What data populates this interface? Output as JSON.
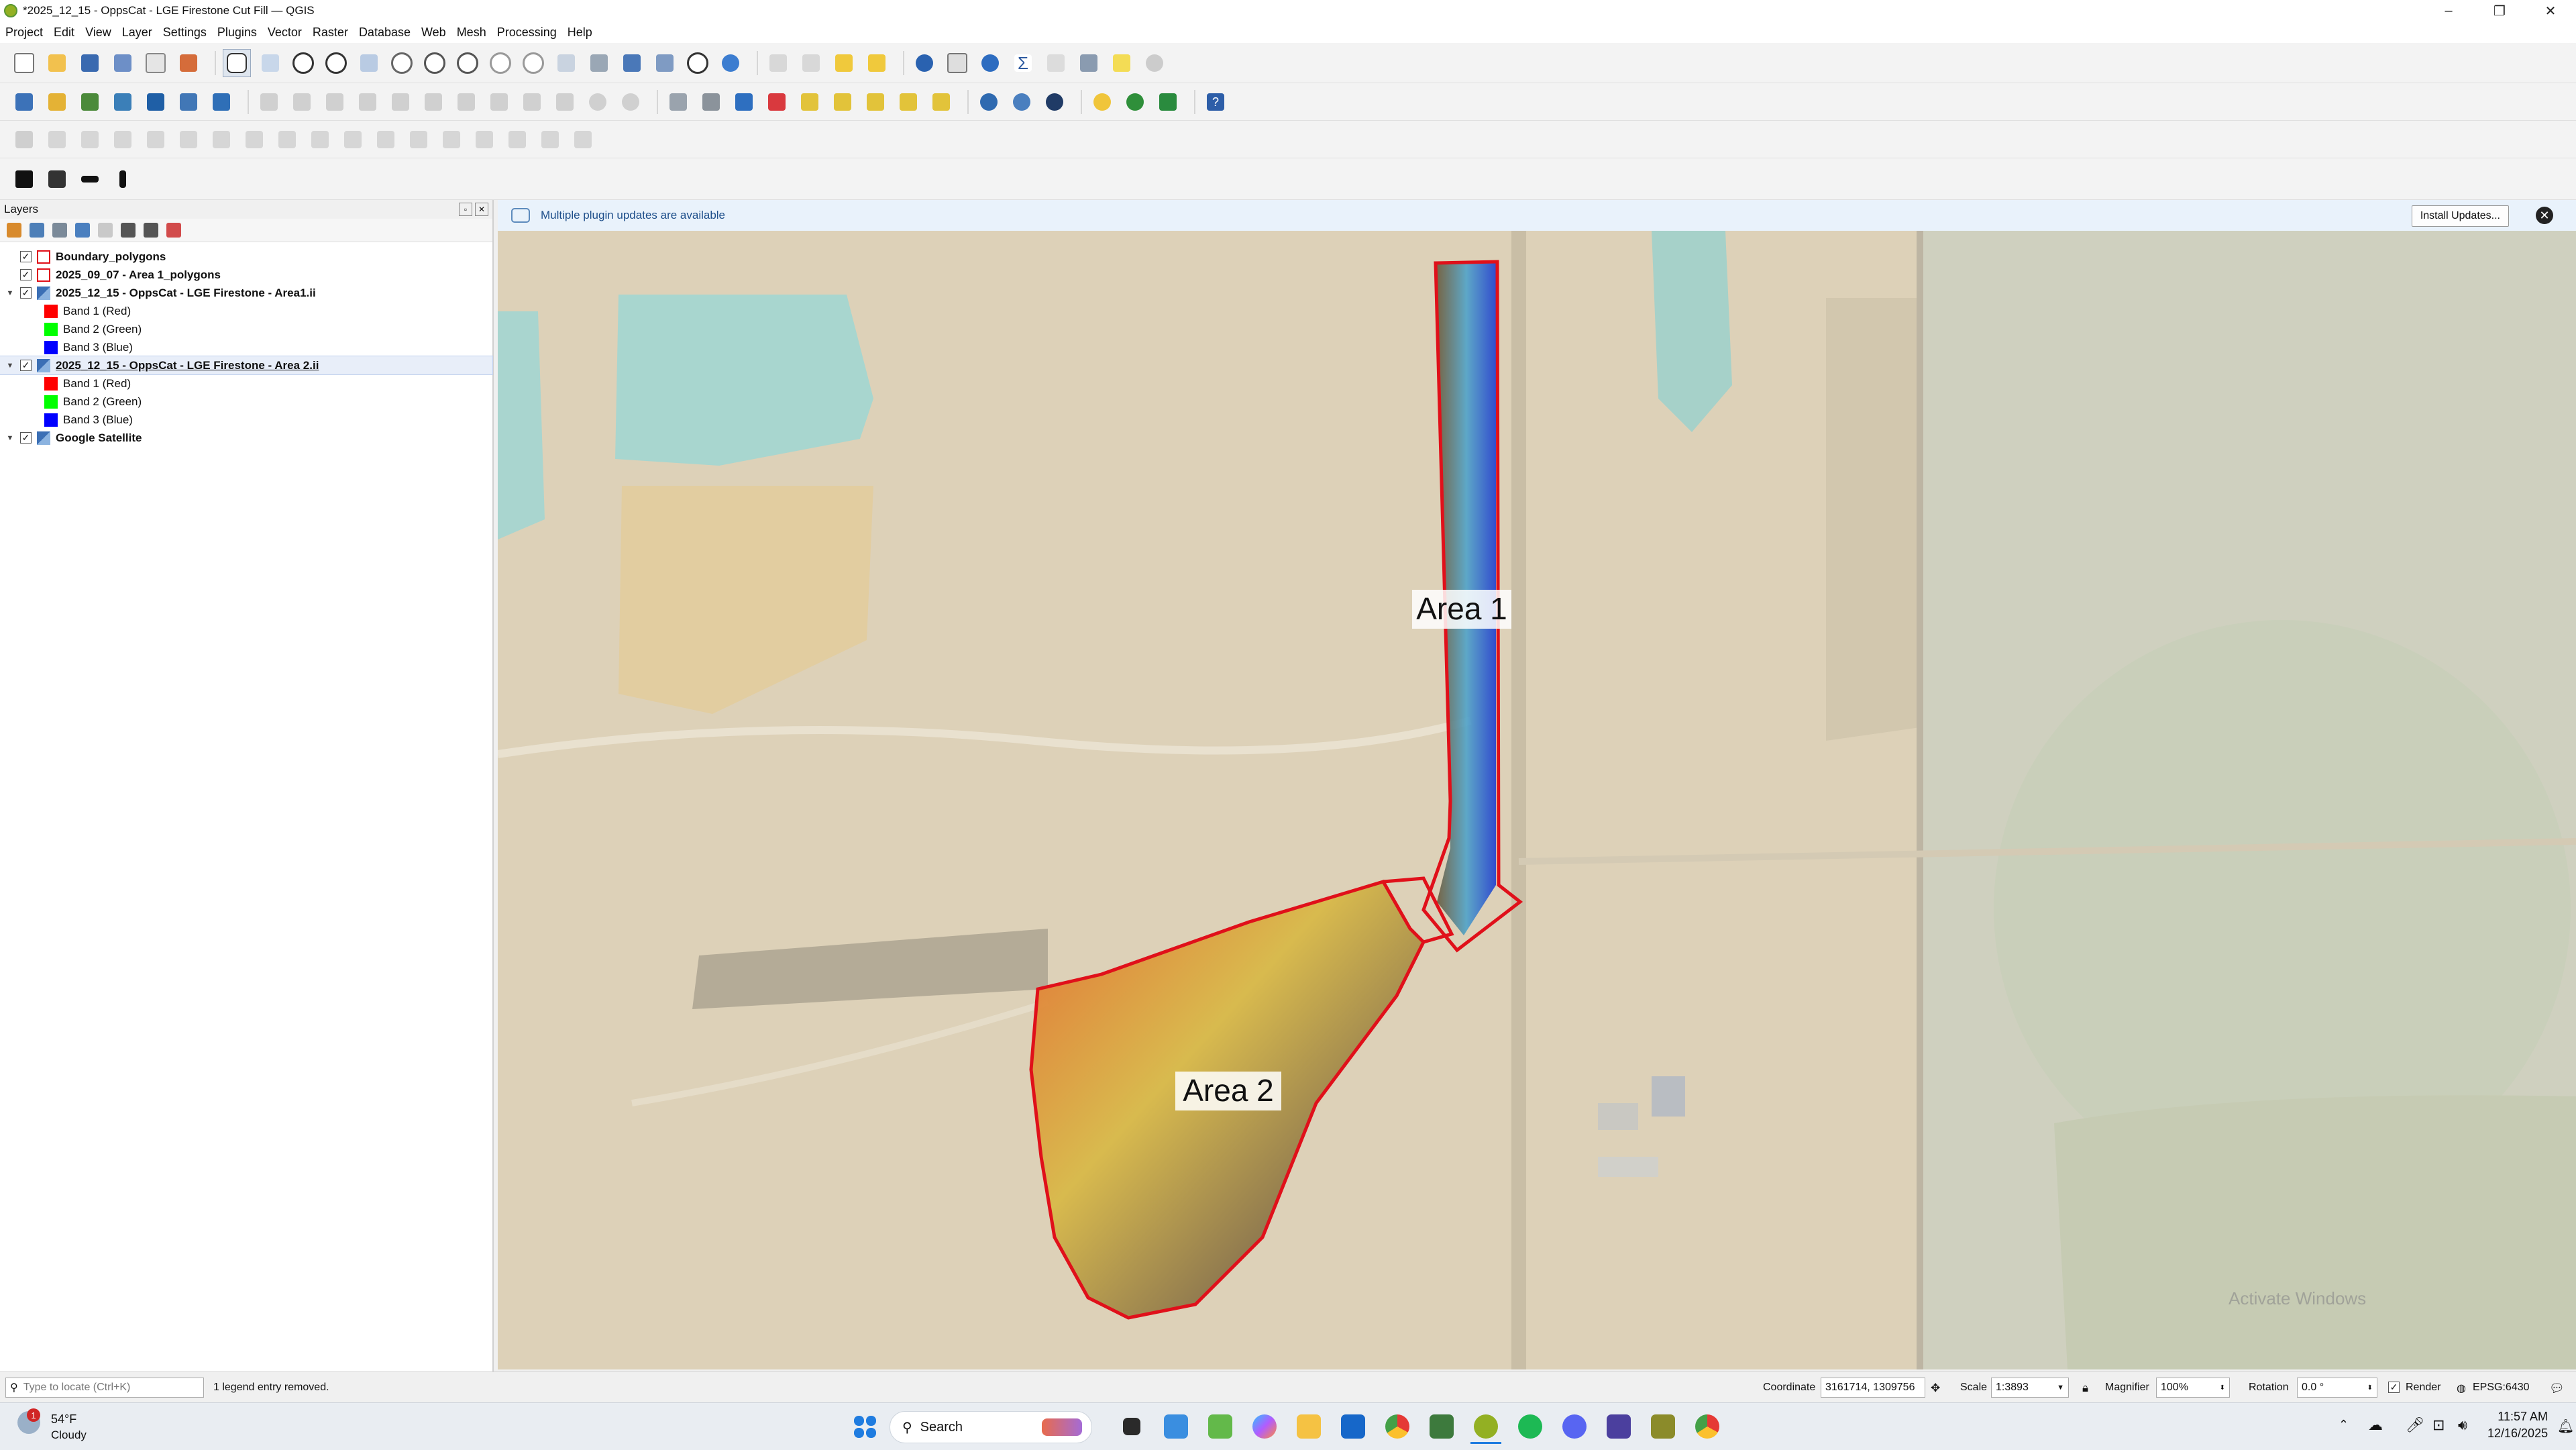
{
  "window": {
    "title": "*2025_12_15 - OppsCat - LGE Firestone Cut Fill — QGIS"
  },
  "menu": [
    "Project",
    "Edit",
    "View",
    "Layer",
    "Settings",
    "Plugins",
    "Vector",
    "Raster",
    "Database",
    "Web",
    "Mesh",
    "Processing",
    "Help"
  ],
  "layers_panel": {
    "title": "Layers",
    "items": [
      {
        "label": "Boundary_polygons",
        "type": "vector"
      },
      {
        "label": "2025_09_07 - Area 1_polygons",
        "type": "vector"
      },
      {
        "label": "2025_12_15 - OppsCat - LGE Firestone - Area1.ii",
        "type": "raster"
      },
      {
        "label": "Band 1 (Red)",
        "type": "band",
        "color": "#ff0000"
      },
      {
        "label": "Band 2 (Green)",
        "type": "band",
        "color": "#00ff00"
      },
      {
        "label": "Band 3 (Blue)",
        "type": "band",
        "color": "#0000ff"
      },
      {
        "label": "2025_12_15 - OppsCat - LGE Firestone - Area 2.ii",
        "type": "raster"
      },
      {
        "label": "Band 1 (Red)",
        "type": "band",
        "color": "#ff0000"
      },
      {
        "label": "Band 2 (Green)",
        "type": "band",
        "color": "#00ff00"
      },
      {
        "label": "Band 3 (Blue)",
        "type": "band",
        "color": "#0000ff"
      },
      {
        "label": "Google Satellite",
        "type": "raster"
      }
    ]
  },
  "banner": {
    "message": "Multiple plugin updates are available",
    "button": "Install Updates..."
  },
  "map": {
    "labels": {
      "area1": "Area 1",
      "area2": "Area 2"
    },
    "watermark": "Activate Windows",
    "boundary_color": "#e0101a"
  },
  "statusbar": {
    "locate_placeholder": "Type to locate (Ctrl+K)",
    "message": "1 legend entry removed.",
    "coordinate_label": "Coordinate",
    "coordinate": "3161714, 1309756",
    "scale_label": "Scale",
    "scale": "1:3893",
    "magnifier_label": "Magnifier",
    "magnifier": "100%",
    "rotation_label": "Rotation",
    "rotation": "0.0 °",
    "render_label": "Render",
    "crs": "EPSG:6430"
  },
  "taskbar": {
    "weather_temp": "54°F",
    "weather_desc": "Cloudy",
    "weather_badge": "1",
    "search": "Search",
    "time": "11:57 AM",
    "date": "12/16/2025"
  }
}
